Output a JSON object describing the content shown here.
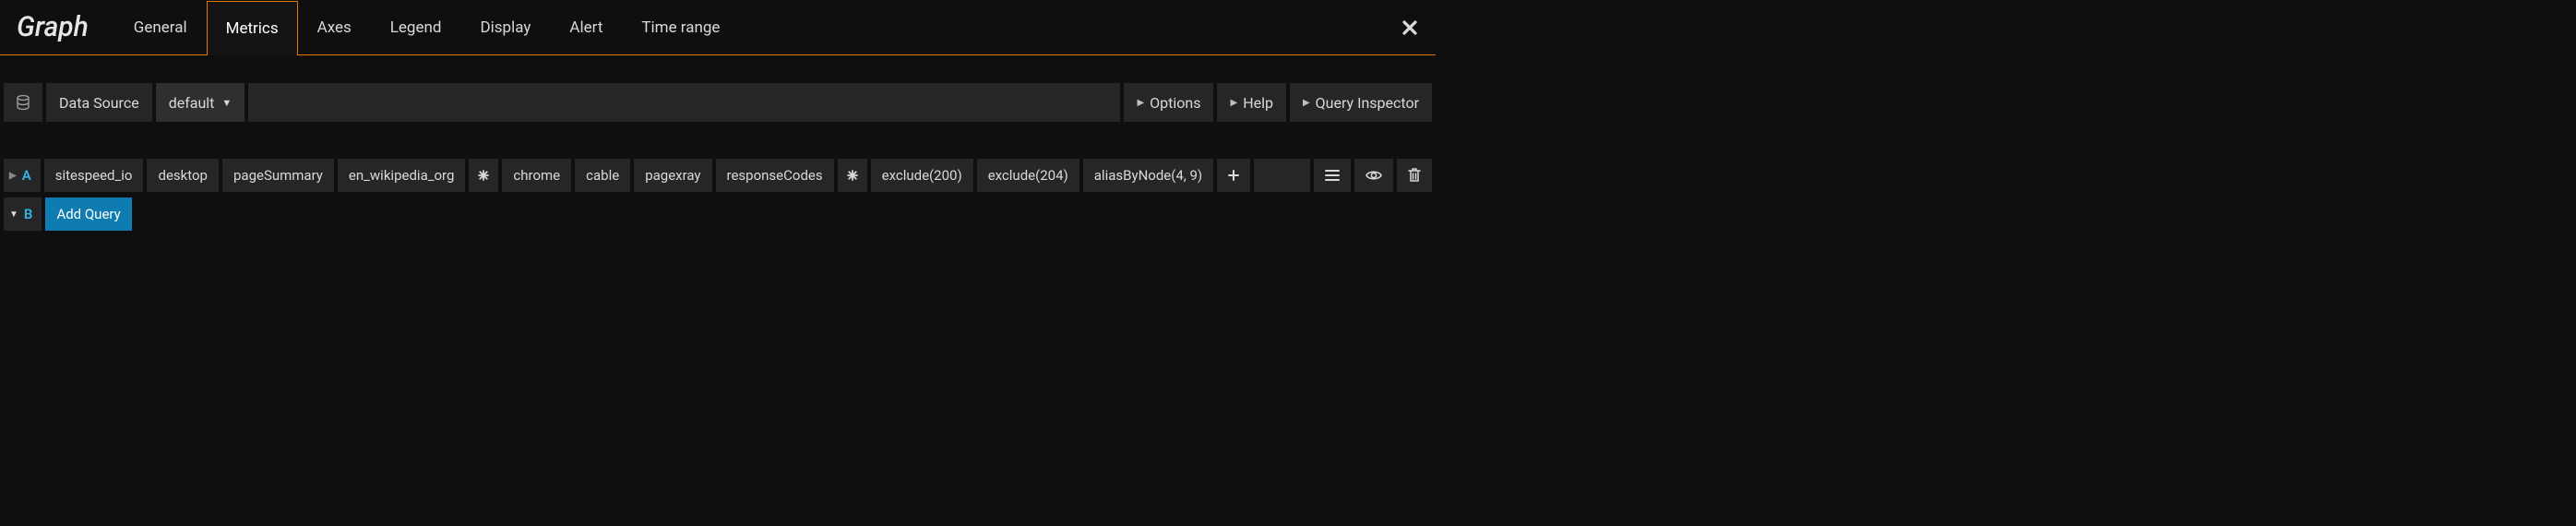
{
  "header": {
    "title": "Graph",
    "tabs": [
      {
        "label": "General",
        "active": false
      },
      {
        "label": "Metrics",
        "active": true
      },
      {
        "label": "Axes",
        "active": false
      },
      {
        "label": "Legend",
        "active": false
      },
      {
        "label": "Display",
        "active": false
      },
      {
        "label": "Alert",
        "active": false
      },
      {
        "label": "Time range",
        "active": false
      }
    ]
  },
  "toolbar": {
    "datasource_label": "Data Source",
    "datasource_value": "default",
    "options_label": "Options",
    "help_label": "Help",
    "inspector_label": "Query Inspector"
  },
  "queries": {
    "rowA": {
      "letter": "A",
      "segments": [
        "sitespeed_io",
        "desktop",
        "pageSummary",
        "en_wikipedia_org",
        "*",
        "chrome",
        "cable",
        "pagexray",
        "responseCodes",
        "*",
        "exclude(200)",
        "exclude(204)",
        "aliasByNode(4, 9)"
      ]
    },
    "rowB": {
      "letter": "B",
      "add_query_label": "Add Query"
    }
  }
}
